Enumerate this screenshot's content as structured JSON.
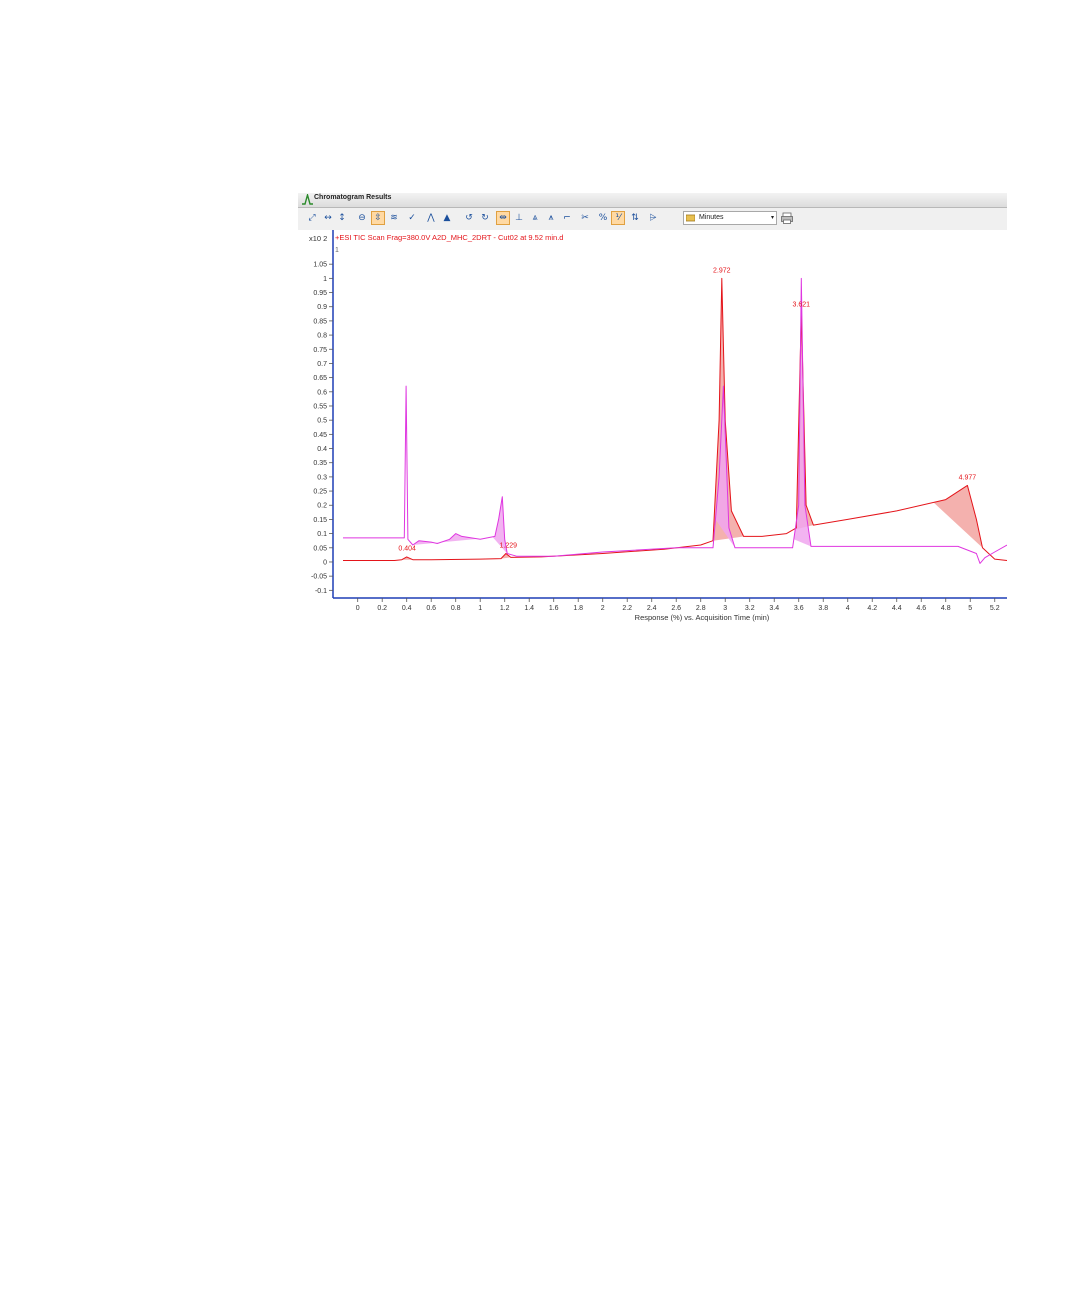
{
  "window": {
    "title": "Chromatogram Results"
  },
  "toolbar": {
    "buttons": [
      {
        "name": "autoscale-both-button",
        "icon": "diagonal-arrows-icon",
        "glyph": "⤢",
        "active": false
      },
      {
        "name": "autoscale-x-button",
        "icon": "horizontal-arrows-icon",
        "glyph": "↔",
        "active": false
      },
      {
        "name": "autoscale-y-button",
        "icon": "vertical-arrows-icon",
        "glyph": "↕",
        "active": false
      },
      {
        "name": "zoom-out-button",
        "icon": "magnifier-icon",
        "glyph": "⊖",
        "active": false
      },
      {
        "name": "autoscale-y-visible-button",
        "icon": "fit-height-icon",
        "glyph": "⇳",
        "active": true
      },
      {
        "name": "overlay-button",
        "icon": "overlay-traces-icon",
        "glyph": "≋",
        "active": false
      },
      {
        "name": "integrate-button",
        "icon": "integrate-icon",
        "glyph": "✓",
        "active": false
      },
      {
        "name": "peak-label-button",
        "icon": "peak-label-icon",
        "glyph": "⋀",
        "active": false
      },
      {
        "name": "peak-fill-button",
        "icon": "peak-fill-icon",
        "glyph": "▲",
        "active": false
      },
      {
        "name": "undo-button",
        "icon": "undo-icon",
        "glyph": "↺",
        "active": false
      },
      {
        "name": "redo-button",
        "icon": "redo-icon",
        "glyph": "↻",
        "active": false
      },
      {
        "name": "link-x-axis-button",
        "icon": "link-x-icon",
        "glyph": "⇹",
        "active": true
      },
      {
        "name": "anchor-button",
        "icon": "anchor-icon",
        "glyph": "⊥",
        "active": false
      },
      {
        "name": "peak-centroid-button",
        "icon": "peak-centroid-icon",
        "glyph": "⩓",
        "active": false
      },
      {
        "name": "peak-split-button",
        "icon": "peak-split-icon",
        "glyph": "⩚",
        "active": false
      },
      {
        "name": "baseline-button",
        "icon": "baseline-icon",
        "glyph": "⌐",
        "active": false
      },
      {
        "name": "remove-peaks-button",
        "icon": "remove-peaks-icon",
        "glyph": "✂",
        "active": false
      },
      {
        "name": "percent-button",
        "icon": "percent-icon",
        "glyph": "%",
        "active": false
      },
      {
        "name": "normalize-button",
        "icon": "normalize-icon",
        "glyph": "⅟",
        "active": true
      },
      {
        "name": "scale-toggle-button",
        "icon": "scale-toggle-icon",
        "glyph": "⇅",
        "active": false
      },
      {
        "name": "peak-list-button",
        "icon": "peak-list-icon",
        "glyph": "⩥",
        "active": false
      }
    ],
    "units_select": {
      "value": "Minutes",
      "arrow": "▾",
      "icon": "units-icon"
    },
    "print_icon": "print-icon"
  },
  "colors": {
    "red_trace": "#e4141a",
    "red_fill": "#f2a3a0",
    "magenta_trace": "#df36e0",
    "magenta_fill": "#f0a6ef",
    "axis": "#1e3fb5",
    "text": "#333333"
  },
  "plot": {
    "trace_title": "+ESI TIC Scan Frag=380.0V A2D_MHC_2DRT - Cut02 at 9.52 min.d",
    "trace_index": "1",
    "y_exponent_label": "x10 2"
  },
  "chart_data": {
    "type": "line",
    "xlabel": "Response (%) vs. Acquisition Time (min)",
    "ylabel": "",
    "xlim": [
      -0.12,
      5.3
    ],
    "ylim": [
      -0.12,
      1.1
    ],
    "x_ticks": [
      "0",
      "0.2",
      "0.4",
      "0.6",
      "0.8",
      "1",
      "1.2",
      "1.4",
      "1.6",
      "1.8",
      "2",
      "2.2",
      "2.4",
      "2.6",
      "2.8",
      "3",
      "3.2",
      "3.4",
      "3.6",
      "3.8",
      "4",
      "4.2",
      "4.4",
      "4.6",
      "4.8",
      "5",
      "5.2"
    ],
    "y_ticks": [
      "-0.1",
      "-0.05",
      "0",
      "0.05",
      "0.1",
      "0.15",
      "0.2",
      "0.25",
      "0.3",
      "0.35",
      "0.4",
      "0.45",
      "0.5",
      "0.55",
      "0.6",
      "0.65",
      "0.7",
      "0.75",
      "0.8",
      "0.85",
      "0.9",
      "0.95",
      "1",
      "1.05"
    ],
    "series": [
      {
        "color": "#e4141a",
        "points": [
          [
            -0.12,
            0.005
          ],
          [
            0.3,
            0.005
          ],
          [
            0.36,
            0.008
          ],
          [
            0.4,
            0.018
          ],
          [
            0.45,
            0.008
          ],
          [
            0.6,
            0.008
          ],
          [
            1.0,
            0.01
          ],
          [
            1.17,
            0.012
          ],
          [
            1.21,
            0.03
          ],
          [
            1.25,
            0.016
          ],
          [
            1.5,
            0.018
          ],
          [
            2.0,
            0.03
          ],
          [
            2.5,
            0.045
          ],
          [
            2.8,
            0.06
          ],
          [
            2.9,
            0.075
          ],
          [
            2.95,
            0.5
          ],
          [
            2.972,
            1.0
          ],
          [
            3.0,
            0.5
          ],
          [
            3.05,
            0.18
          ],
          [
            3.15,
            0.09
          ],
          [
            3.3,
            0.09
          ],
          [
            3.5,
            0.1
          ],
          [
            3.58,
            0.12
          ],
          [
            3.621,
            0.88
          ],
          [
            3.66,
            0.2
          ],
          [
            3.72,
            0.13
          ],
          [
            4.0,
            0.15
          ],
          [
            4.4,
            0.18
          ],
          [
            4.8,
            0.22
          ],
          [
            4.977,
            0.27
          ],
          [
            5.05,
            0.15
          ],
          [
            5.1,
            0.05
          ],
          [
            5.2,
            0.01
          ],
          [
            5.3,
            0.005
          ]
        ]
      },
      {
        "color": "#df36e0",
        "points": [
          [
            -0.12,
            0.085
          ],
          [
            0.38,
            0.085
          ],
          [
            0.395,
            0.62
          ],
          [
            0.41,
            0.08
          ],
          [
            0.45,
            0.06
          ],
          [
            0.5,
            0.075
          ],
          [
            0.6,
            0.07
          ],
          [
            0.65,
            0.065
          ],
          [
            0.75,
            0.08
          ],
          [
            0.8,
            0.1
          ],
          [
            0.85,
            0.09
          ],
          [
            1.0,
            0.08
          ],
          [
            1.12,
            0.09
          ],
          [
            1.15,
            0.15
          ],
          [
            1.18,
            0.23
          ],
          [
            1.2,
            0.08
          ],
          [
            1.22,
            0.03
          ],
          [
            1.3,
            0.02
          ],
          [
            1.6,
            0.02
          ],
          [
            2.0,
            0.035
          ],
          [
            2.6,
            0.05
          ],
          [
            2.9,
            0.05
          ],
          [
            2.95,
            0.3
          ],
          [
            2.985,
            0.62
          ],
          [
            3.03,
            0.12
          ],
          [
            3.08,
            0.05
          ],
          [
            3.55,
            0.05
          ],
          [
            3.6,
            0.2
          ],
          [
            3.621,
            1.0
          ],
          [
            3.65,
            0.2
          ],
          [
            3.7,
            0.055
          ],
          [
            4.9,
            0.055
          ],
          [
            5.05,
            0.03
          ],
          [
            5.08,
            -0.005
          ],
          [
            5.12,
            0.015
          ],
          [
            5.2,
            0.035
          ],
          [
            5.3,
            0.06
          ]
        ]
      }
    ],
    "peak_labels": [
      {
        "text": "0.404",
        "x": 0.404,
        "y": 0.03,
        "color": "#e4141a"
      },
      {
        "text": "1.229",
        "x": 1.229,
        "y": 0.04,
        "color": "#e4141a"
      },
      {
        "text": "2.972",
        "x": 2.972,
        "y": 1.01,
        "color": "#e4141a"
      },
      {
        "text": "3.621",
        "x": 3.621,
        "y": 0.89,
        "color": "#e4141a"
      },
      {
        "text": "4.977",
        "x": 4.977,
        "y": 0.28,
        "color": "#e4141a"
      }
    ]
  }
}
